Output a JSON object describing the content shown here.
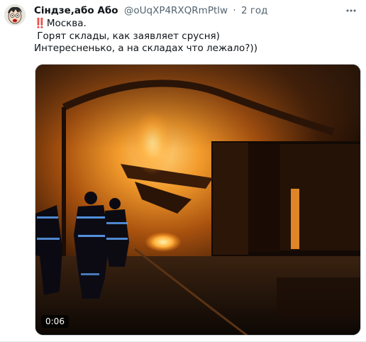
{
  "tweet": {
    "author_name": "Сіндзе,або Або",
    "handle": "@oUqXP4RXQRmPtlw",
    "separator": "·",
    "time": "2 год",
    "more_icon": "more-horizontal-icon",
    "text": {
      "emoji": "‼️",
      "line1": "Москва.",
      "line2": " Горят склады, как заявляет срусня)",
      "line3": "Интересненько, а на складах что лежало?))"
    }
  },
  "media": {
    "type": "video",
    "description_icon": "video-thumbnail",
    "duration": "0:06"
  }
}
